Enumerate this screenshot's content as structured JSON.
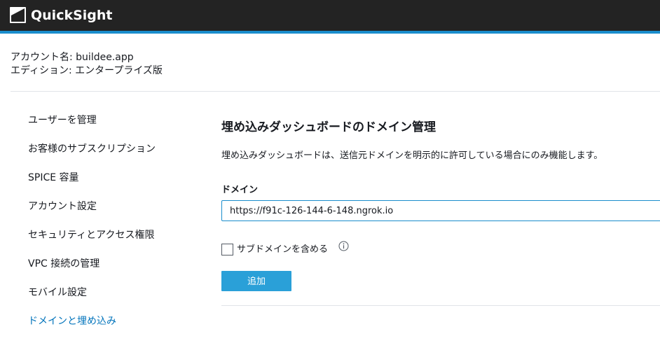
{
  "header": {
    "app_title": "QuickSight",
    "logo_icon": "quicksight-logo-icon",
    "accent_color": "#1a8dcc",
    "background_color": "#232323"
  },
  "account": {
    "name_line": "アカウント名: buildee.app",
    "edition_line": "エディション: エンタープライズ版"
  },
  "sidebar": {
    "active_color": "#0073bb",
    "items": [
      {
        "label": "ユーザーを管理"
      },
      {
        "label": "お客様のサブスクリプション"
      },
      {
        "label": "SPICE 容量"
      },
      {
        "label": "アカウント設定"
      },
      {
        "label": "セキュリティとアクセス権限"
      },
      {
        "label": "VPC 接続の管理"
      },
      {
        "label": "モバイル設定"
      },
      {
        "label": "ドメインと埋め込み",
        "active": true
      }
    ]
  },
  "main": {
    "title": "埋め込みダッシュボードのドメイン管理",
    "description": "埋め込みダッシュボードは、送信元ドメインを明示的に許可している場合にのみ機能します。",
    "domain_label": "ドメイン",
    "domain_value": "https://f91c-126-144-6-148.ngrok.io",
    "include_subdomains_label": "サブドメインを含める",
    "include_subdomains_checked": false,
    "info_icon": "info-icon",
    "add_button_label": "追加",
    "add_button_color": "#2aa0d8"
  }
}
